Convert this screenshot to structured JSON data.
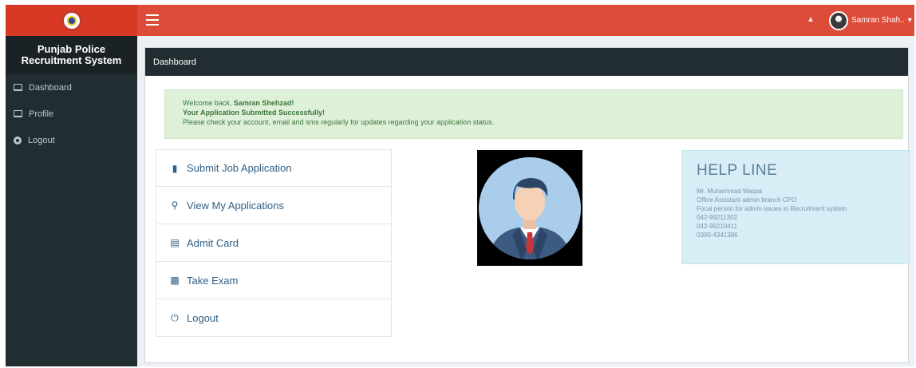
{
  "app": {
    "brand_line1": "Punjab Police",
    "brand_line2": "Recruitment System",
    "user_name": "Samran Shah..",
    "colors": {
      "topbar": "#dd4b39",
      "sidebar": "#222d32",
      "alert_bg": "#dff0d8",
      "helpline_bg": "#d9edf7"
    }
  },
  "sidebar": {
    "items": [
      {
        "label": "Dashboard",
        "icon": "monitor-icon"
      },
      {
        "label": "Profile",
        "icon": "monitor-icon"
      },
      {
        "label": "Logout",
        "icon": "gear-icon"
      }
    ]
  },
  "panel": {
    "title": "Dashboard"
  },
  "alert": {
    "welcome_prefix": "Welcome back,",
    "welcome_name": "Samran Shehzad!",
    "line2": "Your Application Submitted Successfully!",
    "line3": "Please check your account, email and sms regularly for updates regarding your application status."
  },
  "actions": [
    {
      "label": "Submit Job Application",
      "icon": "folder-icon"
    },
    {
      "label": "View My Applications",
      "icon": "search-icon"
    },
    {
      "label": "Admit Card",
      "icon": "card-icon"
    },
    {
      "label": "Take Exam",
      "icon": "file-icon"
    },
    {
      "label": "Logout",
      "icon": "power-icon"
    }
  ],
  "helpline": {
    "title": "HELP LINE",
    "lines": [
      "Mr. Muhammad Waqas",
      "Office Assistant admin branch CPO",
      "Focal person for admin issues in Recruitment system",
      "042-99211302",
      "042-99210411",
      "0300-4341386"
    ]
  }
}
